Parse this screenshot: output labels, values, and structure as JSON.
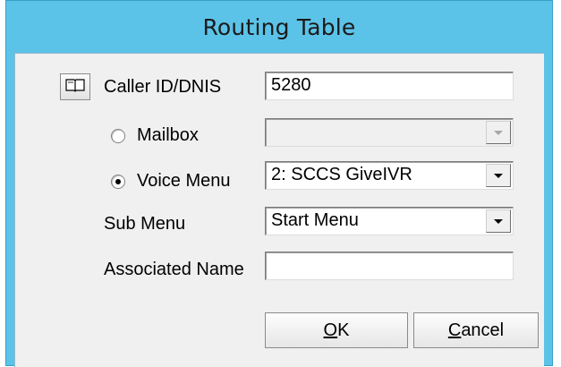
{
  "window": {
    "title": "Routing Table"
  },
  "caller_id": {
    "label": "Caller ID/DNIS",
    "value": "5280",
    "book_icon": "address-book-icon"
  },
  "mailbox": {
    "label": "Mailbox",
    "selected": false,
    "value": "",
    "enabled": false
  },
  "voice_menu": {
    "label": "Voice Menu",
    "selected": true,
    "value": "2: SCCS GiveIVR"
  },
  "sub_menu": {
    "label": "Sub Menu",
    "value": "Start Menu"
  },
  "associated_name": {
    "label": "Associated Name",
    "value": ""
  },
  "buttons": {
    "ok_mnemonic": "O",
    "ok_rest": "K",
    "cancel_mnemonic": "C",
    "cancel_rest": "ancel"
  },
  "colors": {
    "titlebar": "#5cc3e8",
    "client": "#f0f0f0"
  }
}
